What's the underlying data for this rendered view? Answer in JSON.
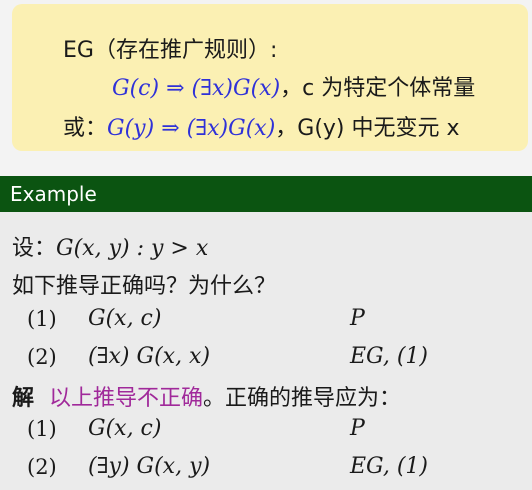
{
  "rule": {
    "title": "EG（存在推广规则）:",
    "line1_lhs": "G(c)",
    "line1_arrow": "⇒",
    "line1_rhs": "(∃x)G(x)",
    "line1_note": "，c 为特定个体常量",
    "line2_prefix": "或：",
    "line2_lhs": "G(y)",
    "line2_arrow": "⇒",
    "line2_rhs": "(∃x)G(x)",
    "line2_note": "，G(y) 中无变元 x"
  },
  "example": {
    "header": "Example",
    "premise_prefix": "设：",
    "premise_math": "G(x, y) : y > x",
    "question": "如下推导正确吗？为什么？",
    "steps": [
      {
        "num": "(1)",
        "formula": "G(x, c)",
        "reason": "P"
      },
      {
        "num": "(2)",
        "formula": "(∃x) G(x, x)",
        "reason": "EG, (1)"
      }
    ],
    "answer_label": "解",
    "answer_wrong": "以上推导不正确",
    "answer_rest": "。正确的推导应为：",
    "correct_steps": [
      {
        "num": "(1)",
        "formula": "G(x, c)",
        "reason": "P"
      },
      {
        "num": "(2)",
        "formula": "(∃y) G(x, y)",
        "reason": "EG, (1)"
      }
    ]
  },
  "colors": {
    "rule_bg": "#fbf0b3",
    "header_bg": "#0b5411",
    "formula_blue": "#2f31d8",
    "highlight_purple": "#a0299a"
  }
}
